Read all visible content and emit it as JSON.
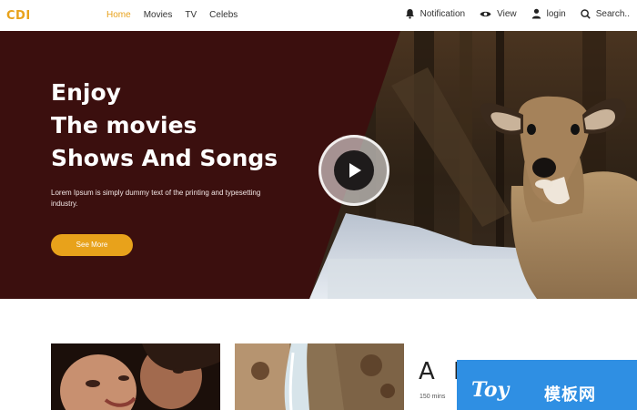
{
  "navbar": {
    "logo": "CDI",
    "links": [
      {
        "label": "Home",
        "active": true
      },
      {
        "label": "Movies",
        "active": false
      },
      {
        "label": "TV",
        "active": false
      },
      {
        "label": "Celebs",
        "active": false
      }
    ],
    "tools": [
      {
        "label": "Notification",
        "icon": "bell-icon"
      },
      {
        "label": "View",
        "icon": "eye-icon"
      },
      {
        "label": "login",
        "icon": "user-icon"
      },
      {
        "label": "Search..",
        "icon": "search-icon"
      }
    ]
  },
  "hero": {
    "title_lines": [
      "Enjoy",
      "The movies",
      "Shows And Songs"
    ],
    "description": "Lorem Ipsum is simply dummy text of the printing and typesetting industry.",
    "cta_label": "See More",
    "play_icon": "play-icon"
  },
  "section": {
    "heading": "A R",
    "subtext": "150 mins"
  },
  "watermark": {
    "text": "Toy",
    "text_cn": "模板网"
  },
  "colors": {
    "accent": "#e8a21b",
    "hero_panel": "#3b0f0e",
    "watermark_bg": "#2f8fe3"
  }
}
